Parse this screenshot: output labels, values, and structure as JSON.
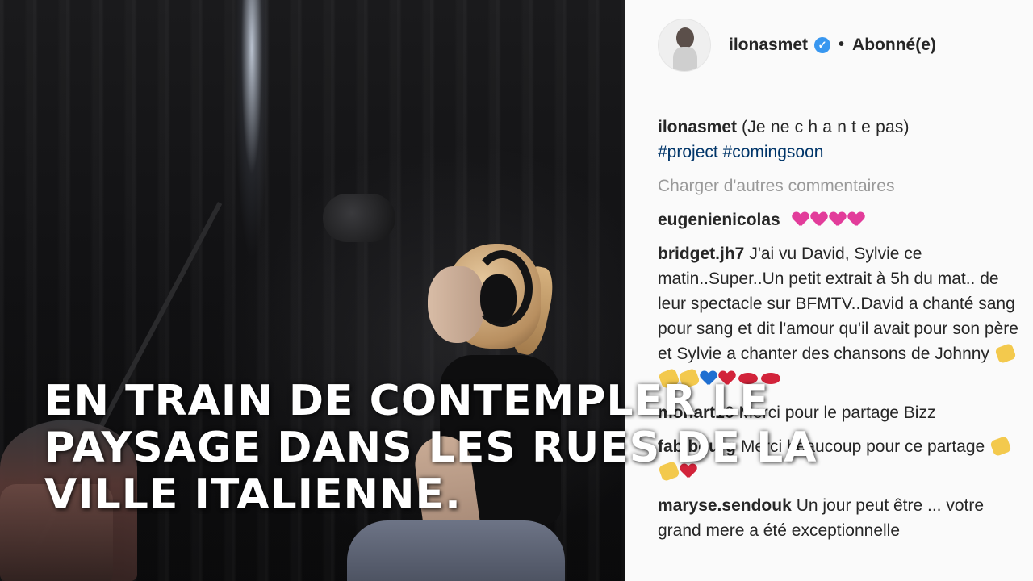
{
  "post": {
    "username": "ilonasmet",
    "verified": true,
    "separator": "•",
    "follow_status": "Abonné(e)"
  },
  "caption": {
    "username": "ilonasmet",
    "text": "(Je ne c h a n t e pas)",
    "hashtags": "#project #comingsoon"
  },
  "load_more": "Charger d'autres commentaires",
  "comments": [
    {
      "user": "eugenienicolas",
      "text": "",
      "emojis": [
        "pink-heart",
        "pink-heart",
        "pink-heart",
        "pink-heart"
      ]
    },
    {
      "user": "bridget.jh7",
      "text": "J'ai vu David, Sylvie ce matin..Super..Un petit extrait à 5h du mat.. de leur spectacle sur BFMTV..David a chanté sang pour sang et dit l'amour qu'il avait pour son père et Sylvie a chanter des chansons de Johnny",
      "emojis": [
        "clap",
        "clap",
        "clap",
        "blue-heart",
        "red-heart",
        "lips",
        "lips"
      ]
    },
    {
      "user": "monart16",
      "text": "Merci pour le partage Bizz",
      "emojis": []
    },
    {
      "user": "fabibourg",
      "text": "Merci beaucoup pour ce partage",
      "emojis": [
        "clap",
        "clap",
        "red-heart"
      ]
    },
    {
      "user": "maryse.sendouk",
      "text": "Un jour peut être ... votre grand mere a été exceptionnelle",
      "emojis": []
    }
  ],
  "overlay": {
    "text": "EN TRAIN DE CONTEMPLER LE PAYSAGE DANS LES RUES DE LA VILLE ITALIENNE."
  },
  "colors": {
    "hashtag": "#003569",
    "verified": "#3897f0",
    "muted": "#999999",
    "pink_heart": "#e23c9a",
    "blue_heart": "#1f6fd1",
    "red_heart": "#d2233a"
  }
}
